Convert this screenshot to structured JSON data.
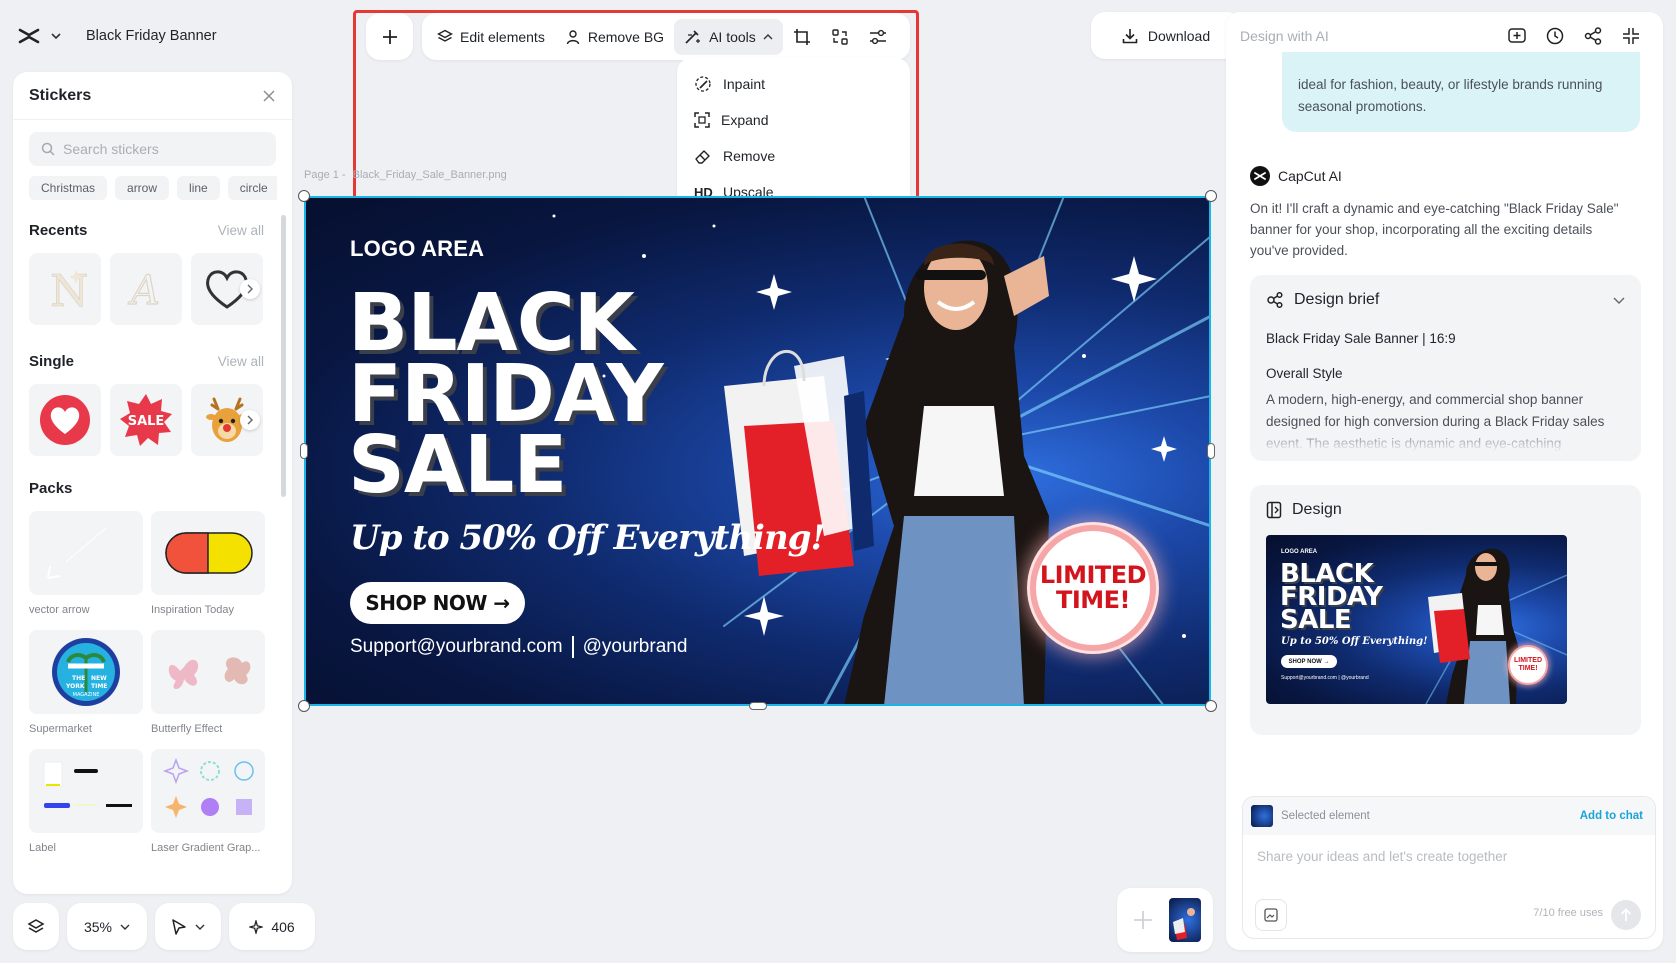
{
  "app": {
    "doc_title": "Black Friday Banner"
  },
  "left_panel": {
    "title": "Stickers",
    "search_placeholder": "Search stickers",
    "chips": [
      "Christmas",
      "arrow",
      "line",
      "circle"
    ],
    "recents": {
      "title": "Recents",
      "view_all": "View all"
    },
    "single": {
      "title": "Single",
      "view_all": "View all",
      "sale_text": "SALE"
    },
    "packs": {
      "title": "Packs",
      "items": [
        {
          "label": "vector arrow"
        },
        {
          "label": "Inspiration Today"
        },
        {
          "label": "Supermarket"
        },
        {
          "label": "Butterfly Effect"
        },
        {
          "label": "Label"
        },
        {
          "label": "Laser Gradient Grap..."
        }
      ],
      "seal_text": [
        "THE",
        "NEW",
        "YORK",
        "TIME",
        "MAGAZINE"
      ]
    }
  },
  "bottom_left": {
    "zoom": "35%",
    "credits": "406"
  },
  "toolbar": {
    "edit_elements": "Edit elements",
    "remove_bg": "Remove BG",
    "ai_tools": "AI tools",
    "ai_menu": [
      {
        "label": "Inpaint",
        "icon": "inpaint-icon"
      },
      {
        "label": "Expand",
        "icon": "expand-icon"
      },
      {
        "label": "Remove",
        "icon": "eraser-icon"
      },
      {
        "label": "Upscale",
        "icon": "hd-icon",
        "badge": "HD"
      }
    ],
    "download": "Download"
  },
  "canvas": {
    "page_label": "Page 1 -",
    "file_name": "Black_Friday_Sale_Banner.png",
    "banner": {
      "logo": "LOGO AREA",
      "title_lines": [
        "BLACK",
        "FRIDAY",
        "SALE"
      ],
      "subtitle": "Up to 50% Off Everything!",
      "cta": "SHOP NOW →",
      "email": "Support@yourbrand.com",
      "handle": "@yourbrand",
      "badge_lines": [
        "LIMITED",
        "TIME!"
      ]
    }
  },
  "right_panel": {
    "title": "Design with AI",
    "user_message": "ideal for fashion, beauty, or lifestyle brands running seasonal promotions.",
    "ai_name": "CapCut AI",
    "ai_text": "On it! I'll craft a dynamic and eye-catching \"Black Friday Sale\" banner for your shop, incorporating all the exciting details you've provided.",
    "brief": {
      "title": "Design brief",
      "line1": "Black Friday Sale Banner | 16:9",
      "style_title": "Overall Style",
      "style_text": "A modern, high-energy, and commercial shop banner designed for high conversion during a Black Friday sales event. The aesthetic is dynamic and eye-catching"
    },
    "design": {
      "title": "Design"
    },
    "composer": {
      "selected": "Selected element",
      "add_to_chat": "Add to chat",
      "placeholder": "Share your ideas and let's create together",
      "uses": "7/10 free uses"
    }
  },
  "colors": {
    "highlight": "#e53935",
    "selection": "#1ab7e6",
    "accent_link": "#1aa3d6",
    "user_bubble": "#d9f3f6"
  }
}
